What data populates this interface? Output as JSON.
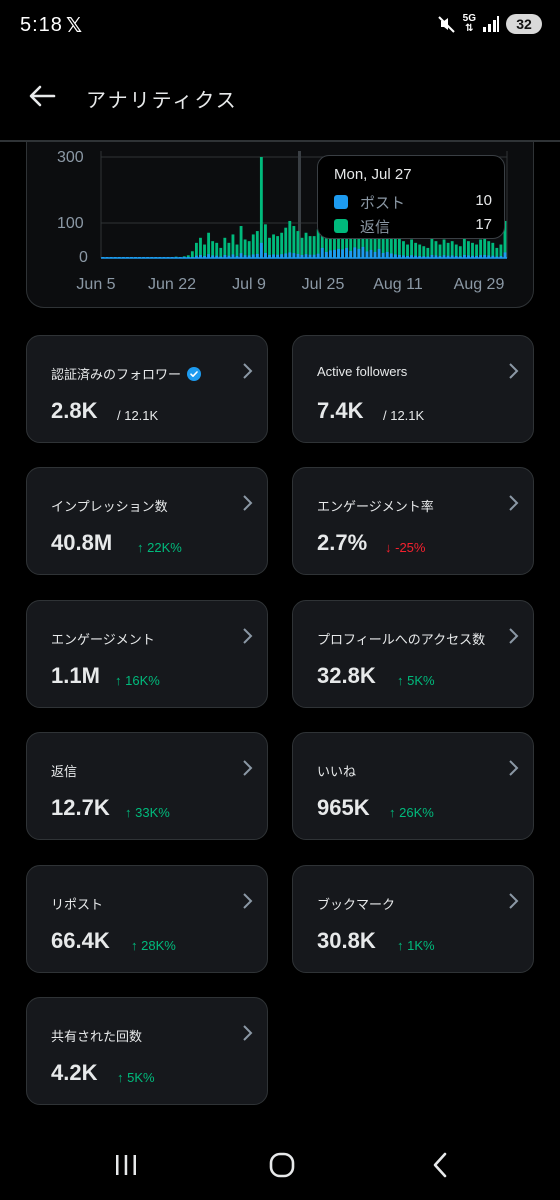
{
  "status_bar": {
    "time": "5:18",
    "app_glyph": "𝕏",
    "network": "5G",
    "battery": "32",
    "icons": [
      "mute-icon",
      "signal-icon",
      "battery-icon"
    ]
  },
  "header": {
    "title": "アナリティクス",
    "back_icon": "arrow-left-icon"
  },
  "chart": {
    "y_ticks": [
      "300",
      "100",
      "0"
    ],
    "x_ticks": [
      "Jun 5",
      "Jun 22",
      "Jul 9",
      "Jul 25",
      "Aug 11",
      "Aug 29"
    ],
    "colors": {
      "posts": "#1d9bf0",
      "replies": "#00ba7c"
    },
    "tooltip": {
      "date": "Mon, Jul 27",
      "rows": [
        {
          "label": "ポスト",
          "value": "10",
          "color": "#1d9bf0"
        },
        {
          "label": "返信",
          "value": "17",
          "color": "#00ba7c"
        }
      ]
    }
  },
  "chart_data": {
    "type": "bar",
    "x_range": [
      "Jun 5",
      "Aug 29"
    ],
    "y_ticks": [
      0,
      100,
      300
    ],
    "ylim": [
      0,
      300
    ],
    "series": [
      {
        "name": "ポスト",
        "color": "#1d9bf0"
      },
      {
        "name": "返信",
        "color": "#00ba7c"
      }
    ],
    "values": [
      2,
      1,
      2,
      1,
      3,
      2,
      1,
      2,
      2,
      1,
      2,
      3,
      2,
      1,
      2,
      2,
      3,
      2,
      4,
      3,
      5,
      8,
      20,
      45,
      60,
      40,
      75,
      50,
      45,
      30,
      60,
      45,
      70,
      40,
      95,
      55,
      50,
      70,
      80,
      300,
      100,
      60,
      70,
      65,
      75,
      90,
      110,
      95,
      80,
      60,
      75,
      65,
      65,
      85,
      200,
      120,
      150,
      160,
      180,
      170,
      200,
      140,
      210,
      180,
      220,
      130,
      160,
      120,
      180,
      100,
      120,
      90,
      70,
      60,
      50,
      40,
      55,
      45,
      40,
      35,
      30,
      60,
      50,
      40,
      55,
      45,
      50,
      40,
      35,
      60,
      50,
      45,
      40,
      55,
      60,
      50,
      45,
      30,
      40,
      110
    ],
    "tooltip": {
      "date": "Mon, Jul 27",
      "ポスト": 10,
      "返信": 17
    }
  },
  "metrics": [
    {
      "label": "認証済みのフォロワー",
      "value": "2.8K",
      "sub": "/ 12.1K",
      "trend": "none",
      "verified": true
    },
    {
      "label": "Active followers",
      "value": "7.4K",
      "sub": "/ 12.1K",
      "trend": "none",
      "verified": false
    },
    {
      "label": "インプレッション数",
      "value": "40.8M",
      "sub": "↑ 22K%",
      "trend": "up",
      "verified": false
    },
    {
      "label": "エンゲージメント率",
      "value": "2.7%",
      "sub": "↓ -25%",
      "trend": "down",
      "verified": false
    },
    {
      "label": "エンゲージメント",
      "value": "1.1M",
      "sub": "↑ 16K%",
      "trend": "up",
      "verified": false
    },
    {
      "label": "プロフィールへのアクセス数",
      "value": "32.8K",
      "sub": "↑ 5K%",
      "trend": "up",
      "verified": false
    },
    {
      "label": "返信",
      "value": "12.7K",
      "sub": "↑ 33K%",
      "trend": "up",
      "verified": false
    },
    {
      "label": "いいね",
      "value": "965K",
      "sub": "↑ 26K%",
      "trend": "up",
      "verified": false
    },
    {
      "label": "リポスト",
      "value": "66.4K",
      "sub": "↑ 28K%",
      "trend": "up",
      "verified": false
    },
    {
      "label": "ブックマーク",
      "value": "30.8K",
      "sub": "↑ 1K%",
      "trend": "up",
      "verified": false
    },
    {
      "label": "共有された回数",
      "value": "4.2K",
      "sub": "↑ 5K%",
      "trend": "up",
      "verified": false
    }
  ],
  "nav": {
    "icons": [
      "recent-apps-icon",
      "home-icon",
      "back-nav-icon"
    ]
  }
}
